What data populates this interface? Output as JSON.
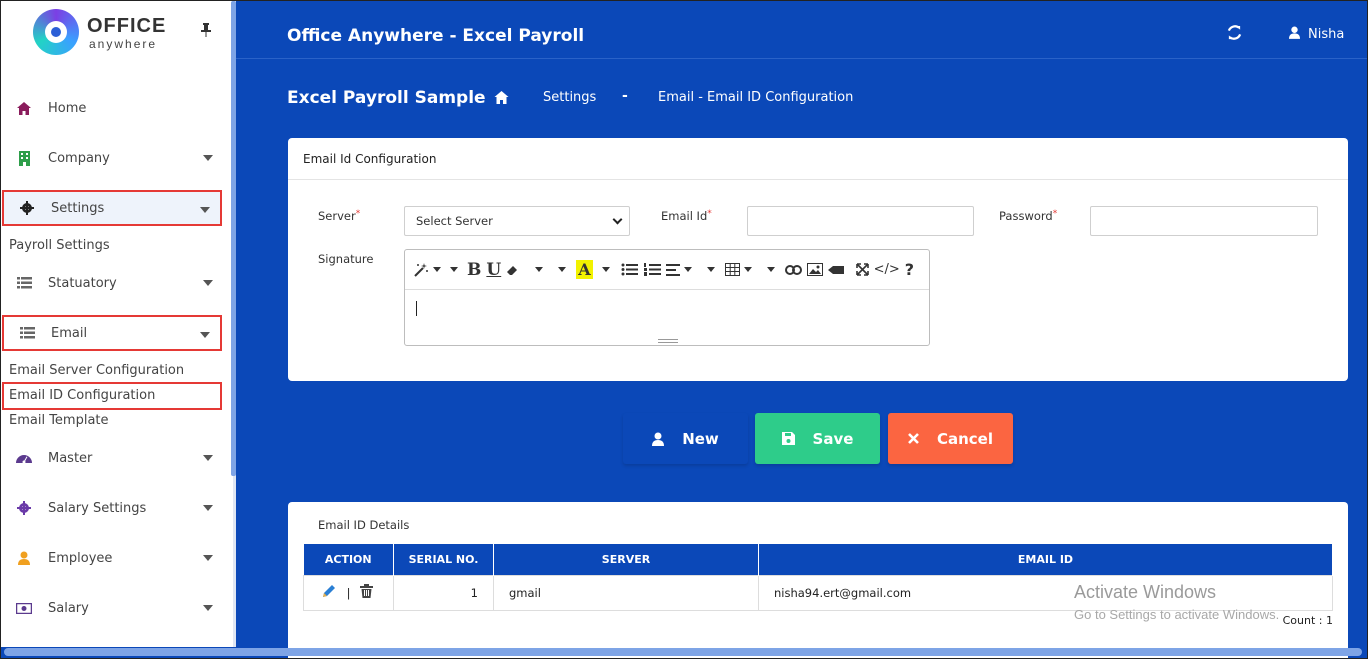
{
  "logo": {
    "word1": "OFFICE",
    "word2": "anywhere"
  },
  "sidebar": {
    "items": [
      {
        "label": "Home",
        "icon": "home-icon"
      },
      {
        "label": "Company",
        "icon": "building-icon"
      },
      {
        "label": "Settings",
        "icon": "gear-icon"
      },
      {
        "label": "Statuatory",
        "icon": "list-icon"
      },
      {
        "label": "Email",
        "icon": "list-icon"
      },
      {
        "label": "Master",
        "icon": "dashboard-icon"
      },
      {
        "label": "Salary Settings",
        "icon": "gear-icon"
      },
      {
        "label": "Employee",
        "icon": "user-icon"
      },
      {
        "label": "Salary",
        "icon": "money-icon"
      }
    ],
    "sub_settings": [
      "Payroll Settings"
    ],
    "sub_email": [
      "Email Server Configuration",
      "Email ID Configuration",
      "Email Template"
    ]
  },
  "header": {
    "title": "Office Anywhere - Excel Payroll",
    "user": "Nisha"
  },
  "breadcrumb": {
    "page": "Excel Payroll Sample",
    "parent": "Settings",
    "sep": "-",
    "current": "Email - Email ID Configuration"
  },
  "form": {
    "heading": "Email Id Configuration",
    "server_label": "Server",
    "server_value": "Select Server",
    "email_label": "Email Id",
    "password_label": "Password",
    "signature_label": "Signature",
    "required_mark": "*"
  },
  "buttons": {
    "new": "New",
    "save": "Save",
    "cancel": "Cancel"
  },
  "details": {
    "title": "Email ID Details",
    "columns": [
      "ACTION",
      "SERIAL NO.",
      "SERVER",
      "EMAIL ID"
    ],
    "rows": [
      {
        "serial": "1",
        "server": "gmail",
        "email": "nisha94.ert@gmail.com"
      }
    ],
    "separator": "|",
    "count": "Count : 1"
  },
  "watermark": {
    "line1": "Activate Windows",
    "line2": "Go to Settings to activate Windows."
  },
  "colors": {
    "primary": "#0b48b8",
    "new": "#0b48b8",
    "save": "#2ecc8a",
    "cancel": "#fb6541",
    "highlight": "#e53935"
  }
}
